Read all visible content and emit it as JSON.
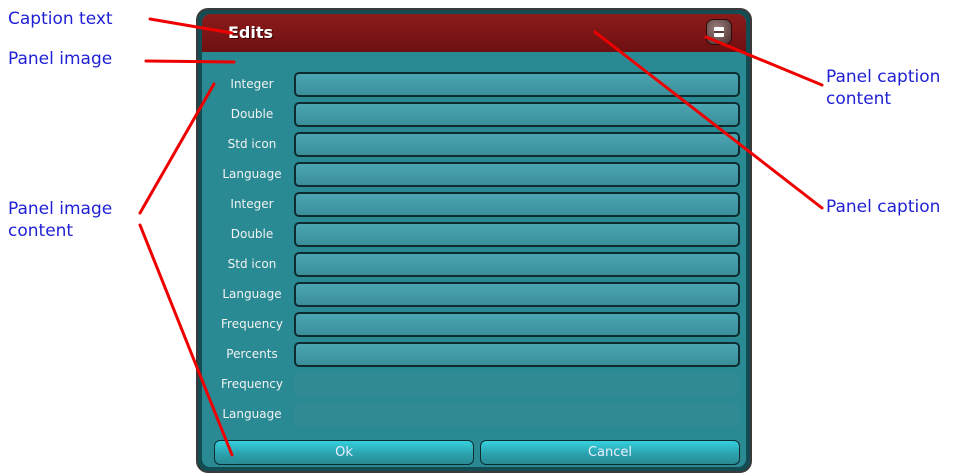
{
  "panel": {
    "caption": "Edits",
    "caption_button_icon": "window-icon",
    "rows": [
      {
        "label": "Integer",
        "enabled": true
      },
      {
        "label": "Double",
        "enabled": true
      },
      {
        "label": "Std icon",
        "enabled": true
      },
      {
        "label": "Language",
        "enabled": true
      },
      {
        "label": "Integer",
        "enabled": true
      },
      {
        "label": "Double",
        "enabled": true
      },
      {
        "label": "Std icon",
        "enabled": true
      },
      {
        "label": "Language",
        "enabled": true
      },
      {
        "label": "Frequency",
        "enabled": true
      },
      {
        "label": "Percents",
        "enabled": true
      },
      {
        "label": "Frequency",
        "enabled": false
      },
      {
        "label": "Language",
        "enabled": false
      }
    ],
    "ok_label": "Ok",
    "cancel_label": "Cancel"
  },
  "callouts": {
    "caption_text": "Caption text",
    "panel_image": "Panel image",
    "panel_image_content": "Panel image\ncontent",
    "panel_caption_content": "Panel caption\ncontent",
    "panel_caption": "Panel caption"
  },
  "colors": {
    "caption_bar": "#7a1414",
    "panel_body": "#2a8a94",
    "callout_text": "#1f1fd6",
    "callout_line": "#ee0000"
  }
}
